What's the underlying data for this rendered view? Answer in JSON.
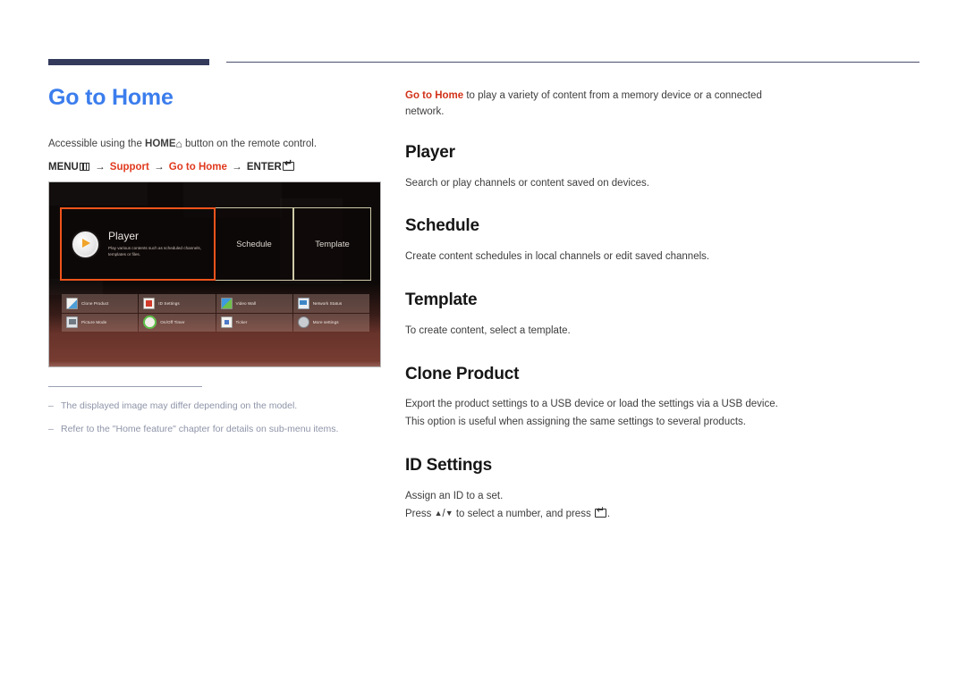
{
  "header": {
    "thick_rule_color": "#333a5c",
    "thin_rule_color": "#4a4f6b"
  },
  "left": {
    "page_title": "Go to Home",
    "title_color": "#3b7ded",
    "accessible_prefix": "Accessible using the ",
    "accessible_bold": "HOME",
    "home_icon": "home-icon",
    "accessible_suffix": " button on the remote control.",
    "menu_path": {
      "menu_label": "MENU",
      "menu_icon": "menu-bars-icon",
      "arrow1": "→",
      "support_label": "Support",
      "arrow2": "→",
      "home_label": "Go to Home",
      "arrow3": "→",
      "enter_label": "ENTER",
      "enter_icon": "enter-key-icon",
      "highlight_color": "#e03a1e"
    }
  },
  "tv_screen": {
    "highlight_color": "#f0541b",
    "tiles": [
      {
        "name": "Player",
        "description": "Play various contents such as scheduled channels, templates or files.",
        "icon": "play-circle-icon",
        "selected": true
      },
      {
        "name": "Schedule",
        "selected": false
      },
      {
        "name": "Template",
        "selected": false
      }
    ],
    "subtiles": [
      {
        "label": "Clone Product",
        "icon": "clone-product-icon"
      },
      {
        "label": "ID Settings",
        "icon": "id-settings-icon"
      },
      {
        "label": "Video Wall",
        "icon": "video-wall-icon"
      },
      {
        "label": "Network Status",
        "icon": "network-status-icon"
      },
      {
        "label": "Picture Mode",
        "icon": "picture-mode-icon"
      },
      {
        "label": "On/Off Timer",
        "icon": "on-off-timer-icon"
      },
      {
        "label": "Ticker",
        "icon": "ticker-icon"
      },
      {
        "label": "More settings",
        "icon": "more-settings-icon"
      }
    ]
  },
  "notes": [
    "The displayed image may differ depending on the model.",
    "Refer to the \"Home feature\" chapter for details on sub-menu items."
  ],
  "right": {
    "lead_bold": "Go to Home",
    "lead_rest": " to play a variety of content from a memory device or a connected network.",
    "sections": [
      {
        "title": "Player",
        "body": "Search or play channels or content saved on devices."
      },
      {
        "title": "Schedule",
        "body": "Create content schedules in local channels or edit saved channels."
      },
      {
        "title": "Template",
        "body": "To create content, select a template."
      },
      {
        "title": "Clone Product",
        "body_line1": "Export the product settings to a USB device or load the settings via a USB device.",
        "body_line2": "This option is useful when assigning the same settings to several products."
      },
      {
        "title": "ID Settings",
        "body_line1": "Assign an ID to a set.",
        "body_line2_a": "Press ",
        "body_line2_up": "▲",
        "body_line2_slash": "/",
        "body_line2_down": "▼",
        "body_line2_b": " to select a number, and press ",
        "body_line2_c": "."
      }
    ]
  }
}
